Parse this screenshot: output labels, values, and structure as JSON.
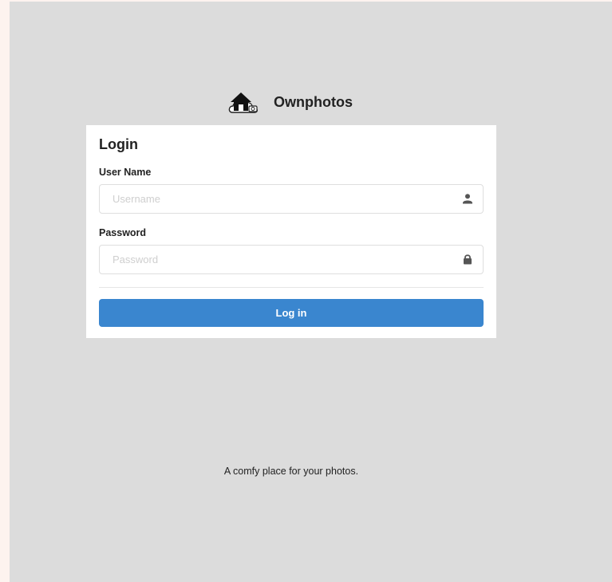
{
  "brand": {
    "name": "Ownphotos",
    "logo_icon": "house-cloud-icon"
  },
  "login": {
    "title": "Login",
    "username": {
      "label": "User Name",
      "placeholder": "Username",
      "value": "",
      "icon": "user-icon"
    },
    "password": {
      "label": "Password",
      "placeholder": "Password",
      "value": "",
      "icon": "lock-icon"
    },
    "submit_label": "Log in"
  },
  "footer": {
    "tagline": "A comfy place for your photos."
  },
  "colors": {
    "page_background": "#dcdcdc",
    "card_background": "#ffffff",
    "primary_button": "#3a86cf"
  }
}
